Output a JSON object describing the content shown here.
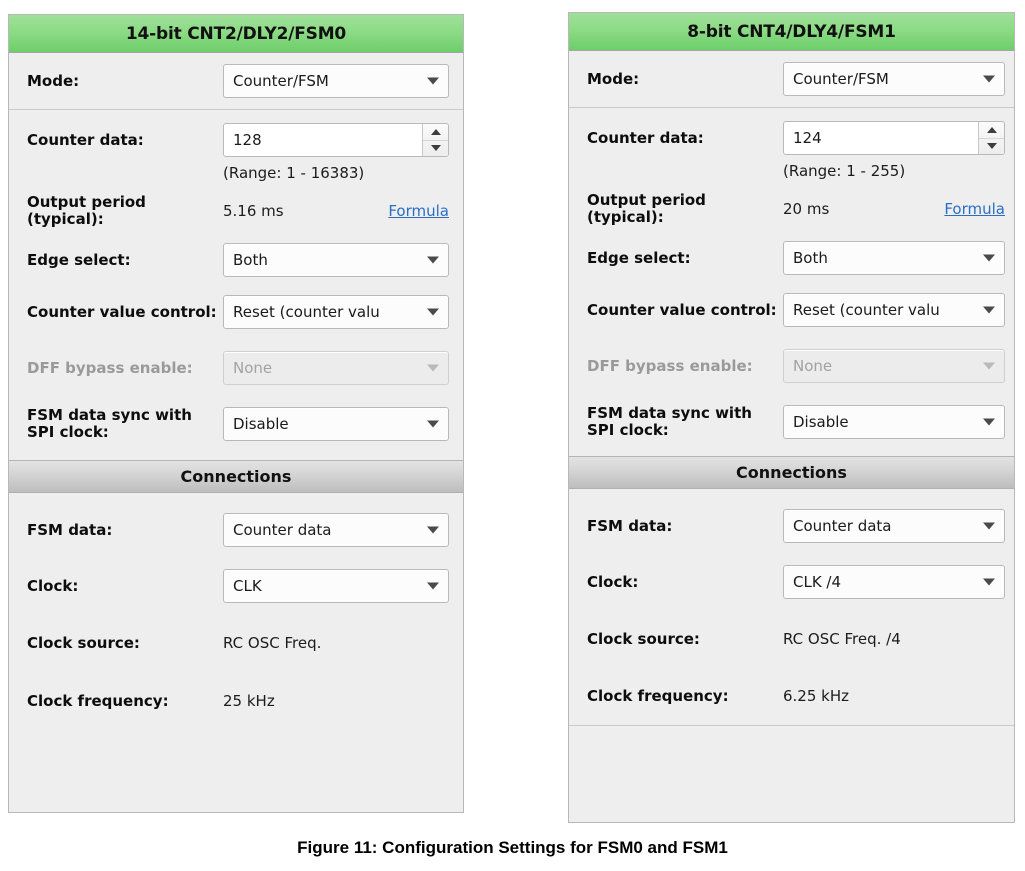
{
  "caption": "Figure 11: Configuration Settings for FSM0 and FSM1",
  "colors": {
    "header_green_light": "#9fe09a",
    "header_green_dark": "#6dce6a",
    "panel_background": "#eeeeee",
    "section_bar": "#d2d2d2",
    "link_blue": "#2a6fc4",
    "disabled_text": "#9a9a9a"
  },
  "panels": [
    {
      "title": "14-bit CNT2/DLY2/FSM0",
      "mode_label": "Mode:",
      "mode_value": "Counter/FSM",
      "counter_data_label": "Counter data:",
      "counter_data_value": "128",
      "range_note": "(Range:  1 - 16383)",
      "output_period_label": "Output period (typical):",
      "output_period_value": "5.16 ms",
      "formula_link": "Formula",
      "edge_select_label": "Edge select:",
      "edge_select_value": "Both",
      "counter_value_control_label": "Counter value control:",
      "counter_value_control_value": "Reset (counter valu",
      "dff_bypass_label": "DFF bypass enable:",
      "dff_bypass_value": "None",
      "fsm_sync_label": "FSM data sync with SPI clock:",
      "fsm_sync_value": "Disable",
      "connections_header": "Connections",
      "fsm_data_label": "FSM data:",
      "fsm_data_value": "Counter data",
      "clock_label": "Clock:",
      "clock_value": "CLK",
      "clock_source_label": "Clock source:",
      "clock_source_value": "RC OSC Freq.",
      "clock_frequency_label": "Clock frequency:",
      "clock_frequency_value": "25 kHz"
    },
    {
      "title": "8-bit CNT4/DLY4/FSM1",
      "mode_label": "Mode:",
      "mode_value": "Counter/FSM",
      "counter_data_label": "Counter data:",
      "counter_data_value": "124",
      "range_note": "(Range:  1 - 255)",
      "output_period_label": "Output period (typical):",
      "output_period_value": "20 ms",
      "formula_link": "Formula",
      "edge_select_label": "Edge select:",
      "edge_select_value": "Both",
      "counter_value_control_label": "Counter value control:",
      "counter_value_control_value": "Reset (counter valu",
      "dff_bypass_label": "DFF bypass enable:",
      "dff_bypass_value": "None",
      "fsm_sync_label": "FSM data sync with SPI clock:",
      "fsm_sync_value": "Disable",
      "connections_header": "Connections",
      "fsm_data_label": "FSM data:",
      "fsm_data_value": "Counter data",
      "clock_label": "Clock:",
      "clock_value": "CLK /4",
      "clock_source_label": "Clock source:",
      "clock_source_value": "RC OSC Freq. /4",
      "clock_frequency_label": "Clock frequency:",
      "clock_frequency_value": "6.25 kHz"
    }
  ]
}
